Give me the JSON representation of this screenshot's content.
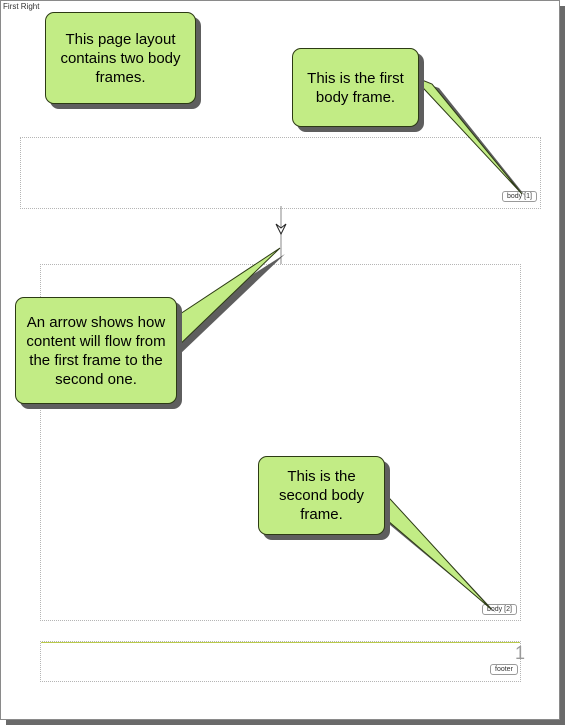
{
  "page": {
    "label": "First Right"
  },
  "frames": {
    "body1_tag": "body [1]",
    "body2_tag": "body [2]",
    "footer_tag": "footer",
    "page_number": "1"
  },
  "callouts": {
    "layout_note": "This page layout\ncontains two body\nframes.",
    "first_frame_note": "This is the first\nbody frame.",
    "arrow_note": "An arrow shows how\ncontent will flow from\nthe first frame to the\nsecond one.",
    "second_frame_note": "This is the\nsecond body\nframe."
  },
  "colors": {
    "callout_fill": "#c2ec85",
    "footer_rule": "#b9c94a"
  }
}
